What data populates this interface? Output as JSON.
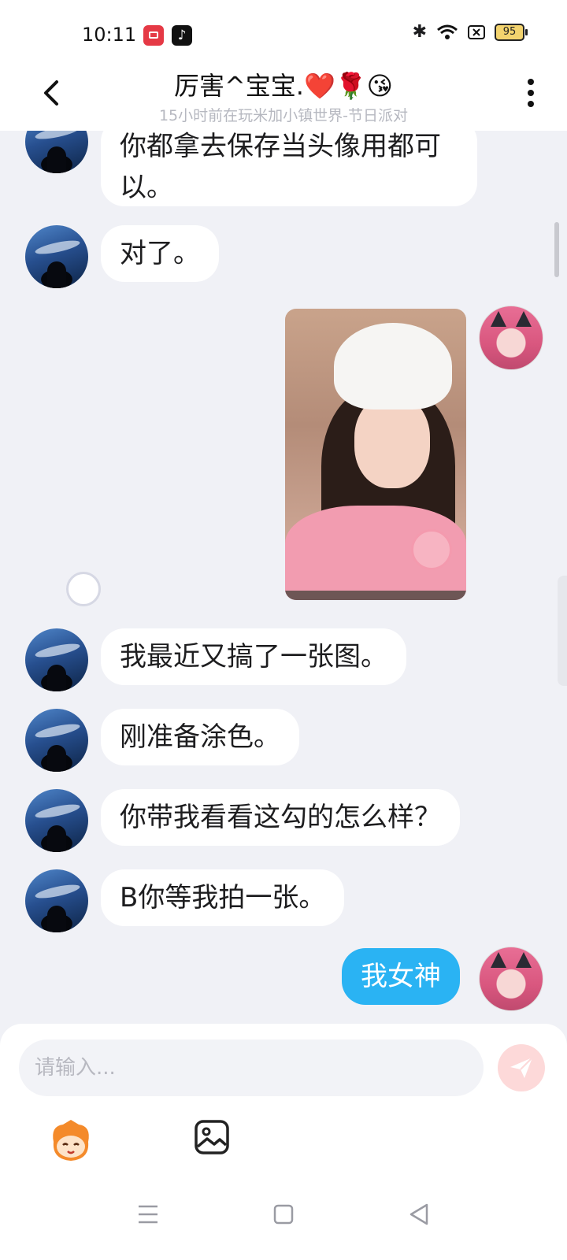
{
  "status_bar": {
    "time": "10:11",
    "battery": "95",
    "icons": [
      "screen-record-icon",
      "tiktok-icon",
      "bluetooth-icon",
      "wifi-icon",
      "sim-icon",
      "battery-icon"
    ]
  },
  "header": {
    "title": "厉害^宝宝.❤️🌹😘",
    "subtitle": "15小时前在玩米加小镇世界-节日派对"
  },
  "messages": [
    {
      "sender": "other",
      "line1": "你都拿去保存当头像用都可",
      "line2": "以。"
    },
    {
      "sender": "other",
      "text": "对了。"
    },
    {
      "sender": "me",
      "type": "image"
    },
    {
      "sender": "other",
      "text": "我最近又搞了一张图。"
    },
    {
      "sender": "other",
      "text": "刚准备涂色。"
    },
    {
      "sender": "other",
      "text": "你带我看看这勾的怎么样？"
    },
    {
      "sender": "other",
      "text": "B你等我拍一张。"
    },
    {
      "sender": "me",
      "text": "我女神"
    }
  ],
  "composer": {
    "placeholder": "请输入..."
  },
  "colors": {
    "accent": "#2ab3f3",
    "background": "#f0f1f6",
    "send_disabled": "#fdd9d9"
  }
}
